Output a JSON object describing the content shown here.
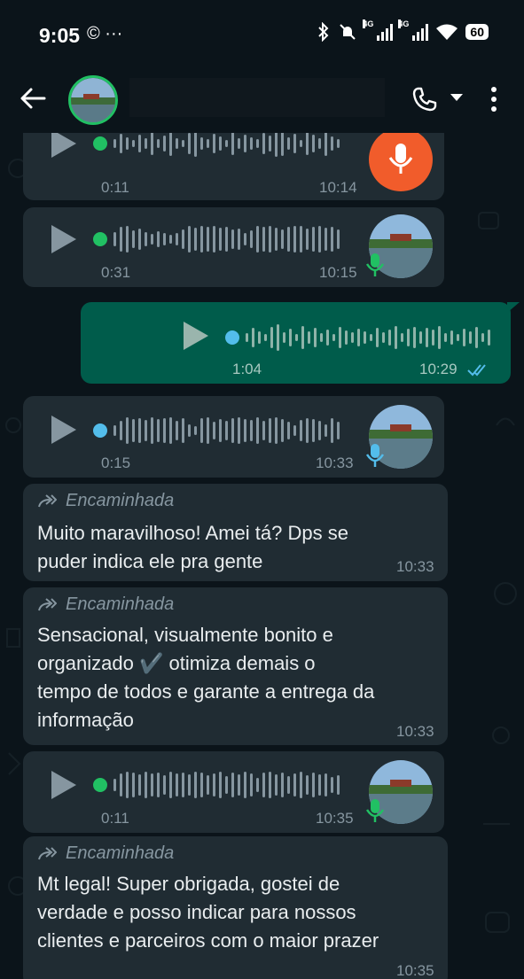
{
  "status_bar": {
    "time": "9:05",
    "left_icons": "© ···",
    "network_1": "4G",
    "network_2": "4G",
    "battery": "60"
  },
  "header": {
    "back_icon": "back-arrow-icon",
    "call_icon": "phone-icon",
    "menu_icon": "more-vert-icon"
  },
  "colors": {
    "bg": "#0b141a",
    "incoming": "#202c33",
    "outgoing": "#005c4b",
    "green_dot": "#21c063",
    "blue_dot": "#53bdeb",
    "record": "#f15c2b"
  },
  "messages": [
    {
      "type": "audio",
      "direction": "in",
      "duration": "0:11",
      "time": "10:14",
      "status_dot": "played"
    },
    {
      "type": "audio",
      "direction": "in",
      "duration": "0:31",
      "time": "10:15",
      "status_dot": "played"
    },
    {
      "type": "audio",
      "direction": "out",
      "duration": "1:04",
      "time": "10:29",
      "status_dot": "unplayed"
    },
    {
      "type": "audio",
      "direction": "in",
      "duration": "0:15",
      "time": "10:33",
      "status_dot": "unplayed"
    },
    {
      "type": "text",
      "direction": "in",
      "forwarded_label": "Encaminhada",
      "lines": [
        "Muito maravilhoso! Amei tá? Dps se",
        "puder indica ele pra gente"
      ],
      "time": "10:33"
    },
    {
      "type": "text",
      "direction": "in",
      "forwarded_label": "Encaminhada",
      "lines": [
        "Sensacional, visualmente bonito e",
        "organizado ✔️ otimiza demais o",
        "tempo de todos e garante a entrega da",
        "informação"
      ],
      "time": "10:33"
    },
    {
      "type": "audio",
      "direction": "in",
      "duration": "0:11",
      "time": "10:35",
      "status_dot": "played"
    },
    {
      "type": "text",
      "direction": "in",
      "forwarded_label": "Encaminhada",
      "lines": [
        "Mt legal! Super obrigada, gostei de",
        "verdade e posso indicar para nossos",
        "clientes e parceiros com o maior prazer"
      ],
      "time": "10:35"
    }
  ]
}
